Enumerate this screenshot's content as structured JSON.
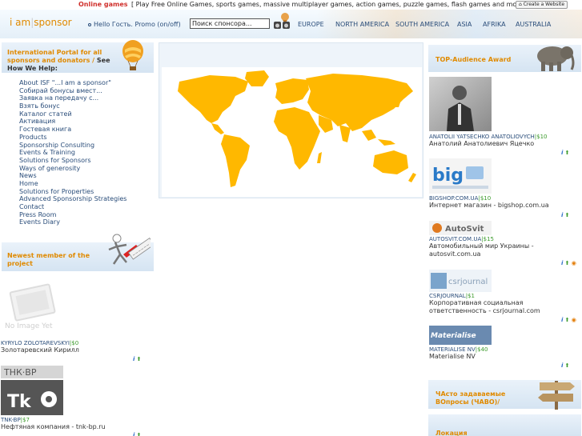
{
  "topbar": {
    "online_games": "Online games",
    "games_desc": "[ Play Free Online Games, sports games, massive multiplayer games, action games, puzzle games, flash games and more. ]",
    "create_website": "Create a Website"
  },
  "header": {
    "logo_left": "i am",
    "logo_sep": "|",
    "logo_right": "sponsor",
    "greeting": "Hello Гость. Promo (on/off)",
    "search_value": "Поиск спонсора...",
    "regions": [
      "EUROPE",
      "NORTH AMERICA",
      "SOUTH AMERICA",
      "ASIA",
      "AFRIKA",
      "AUSTRALIA"
    ]
  },
  "left_panel": {
    "title": "International Portal for all sponsors and donators /",
    "see": "See How We Help:",
    "nav": [
      "About ISF \"...I am a sponsor\"",
      "Собирай бонусы вмест...",
      "Заявка на передачу с...",
      "Взять бонус",
      "Каталог статей",
      "Активация",
      "Гостевая книга",
      "Products",
      "Sponsorship Consulting",
      "Events & Training",
      "Solutions for Sponsors",
      "Ways of generosity",
      "News",
      "Home",
      "Solutions for Properties",
      "Advanced Sponsorship Strategies",
      "Contact",
      "Press Room",
      "Events Diary"
    ],
    "newest_title": "Newest member of the project",
    "no_image_text": "No Image Yet",
    "members": [
      {
        "name": "KYRYLO ZOLOTAREVSKYI",
        "amount": "$0",
        "desc": "Золотаревский Кирилл"
      },
      {
        "name": "TNK-BP",
        "amount": "$7",
        "desc": "Нефтяная компания - tnk-bp.ru",
        "logo_text": "ТНК·ВР"
      }
    ]
  },
  "right_panel": {
    "title": "TOP-Audience Award",
    "sponsors": [
      {
        "name": "ANATOLII YATSECHKO ANATOLIOVYCH",
        "amount": "$10",
        "desc": [
          "Анатолий Анатолиевич Яцечко"
        ]
      },
      {
        "name": "BIGSHOP.COM.UA",
        "amount": "$10",
        "desc": [
          "Интернет магазин - bigshop.com.ua"
        ],
        "logo_text": "big"
      },
      {
        "name": "AUTOSVIT.COM.UA",
        "amount": "$15",
        "desc": [
          "Автомобильный мир Украины -",
          "autosvit.com.ua"
        ],
        "logo_text": "AutoSvit"
      },
      {
        "name": "CSRJOURNAL",
        "amount": "$1",
        "desc": [
          "Корпоративная социальная",
          "ответственность - csrjournal.com"
        ],
        "logo_text": "csrjournal"
      },
      {
        "name": "MATERIALISE NV",
        "amount": "$40",
        "desc": [
          "Materialise NV"
        ],
        "logo_text": "Materialise"
      }
    ],
    "faq": "ЧАсто задаваемые ВОпросы (ЧАВО)/",
    "location": "Локация"
  },
  "colors": {
    "accent": "#e08a00",
    "link": "#2a4d7a",
    "amount": "#3a9a2a",
    "map": "#ffb800"
  }
}
